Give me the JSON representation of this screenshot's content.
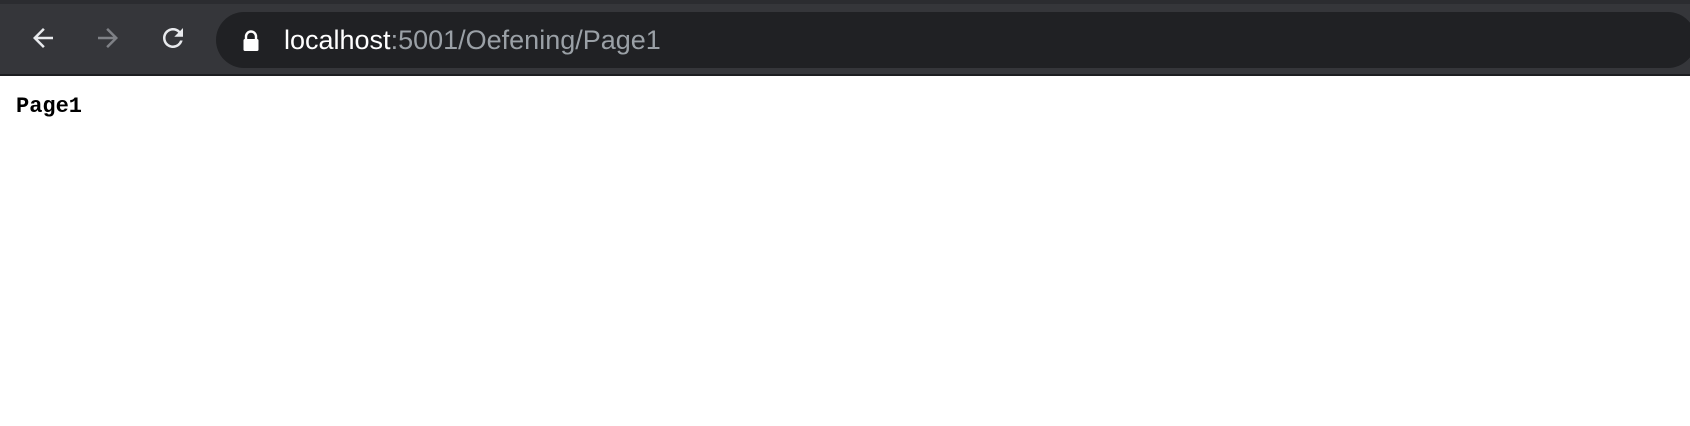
{
  "browser": {
    "toolbar": {
      "back_icon": "arrow-left-icon",
      "forward_icon": "arrow-right-icon",
      "reload_icon": "reload-icon",
      "forward_enabled": false
    },
    "address_bar": {
      "secure_icon": "lock-icon",
      "host": "localhost",
      "path": ":5001/Oefening/Page1"
    },
    "colors": {
      "toolbar_bg": "#35363a",
      "omnibox_bg": "#202124",
      "host_text": "#ffffff",
      "path_text": "#9aa0a6"
    }
  },
  "page": {
    "heading": "Page1"
  }
}
